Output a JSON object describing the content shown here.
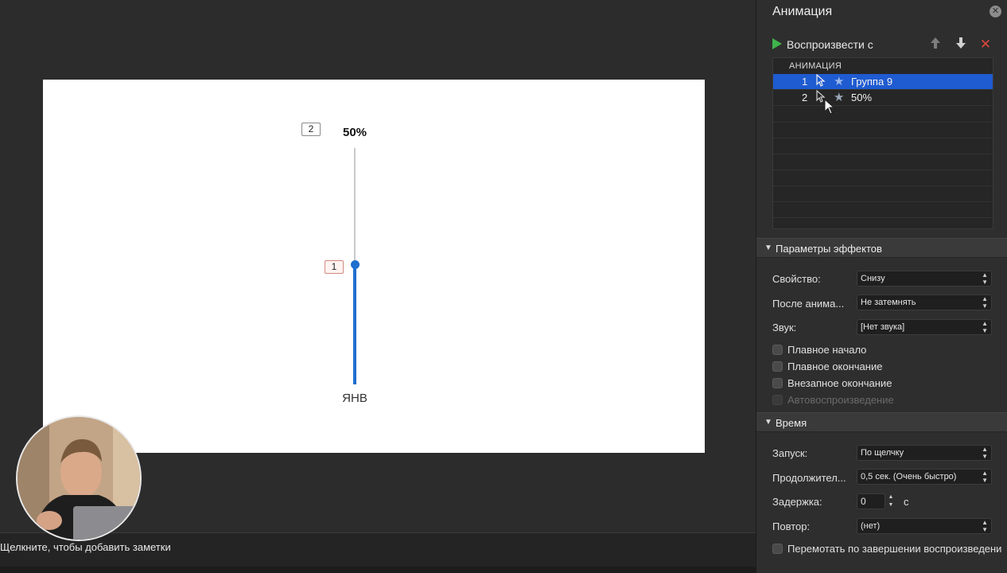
{
  "slide": {
    "tag_top": "2",
    "tag_mid": "1",
    "percent": "50%",
    "month": "ЯНВ"
  },
  "notes": {
    "placeholder": "Щелкните, чтобы добавить заметки"
  },
  "panel": {
    "title": "Анимация",
    "close_glyph": "✕",
    "play_label": "Воспроизвести с",
    "up_glyph": "🡅",
    "down_glyph": "🡇",
    "delete_glyph": "✕",
    "list_header": "АНИМАЦИЯ",
    "items": [
      {
        "num": "1",
        "label": "Группа 9",
        "selected": true
      },
      {
        "num": "2",
        "label": "50%",
        "selected": false
      }
    ],
    "effects_section": "Параметры эффектов",
    "effects": {
      "property_label": "Свойство:",
      "property_value": "Снизу",
      "after_label": "После анима...",
      "after_value": "Не затемнять",
      "sound_label": "Звук:",
      "sound_value": "[Нет звука]",
      "smooth_start": "Плавное начало",
      "smooth_end": "Плавное окончание",
      "bounce_end": "Внезапное окончание",
      "auto_reverse": "Автовоспроизведение"
    },
    "timing_section": "Время",
    "timing": {
      "start_label": "Запуск:",
      "start_value": "По щелчку",
      "duration_label": "Продолжител...",
      "duration_value": "0,5 сек. (Очень быстро)",
      "delay_label": "Задержка:",
      "delay_value": "0",
      "delay_unit": "с",
      "repeat_label": "Повтор:",
      "repeat_value": "(нет)",
      "rewind_label": "Перемотать по завершении воспроизведени"
    }
  },
  "colors": {
    "accent": "#1f5bd1",
    "chart_blue": "#1f6fcf",
    "play_green": "#3fb24a",
    "delete_red": "#e0453b"
  }
}
